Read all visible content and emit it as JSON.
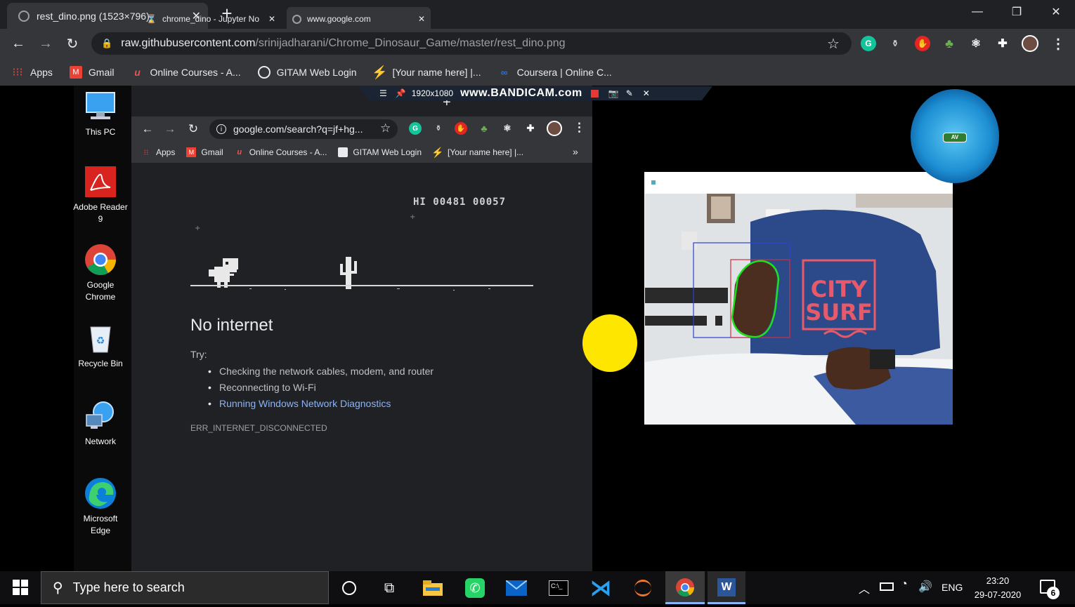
{
  "outer_browser": {
    "tab_title": "rest_dino.png (1523×796)",
    "url_host": "raw.githubusercontent.com",
    "url_path": "/srinijadharani/Chrome_Dinosaur_Game/master/rest_dino.png",
    "bookmarks": [
      {
        "label": "Apps",
        "icon": "apps-grid-icon"
      },
      {
        "label": "Gmail",
        "icon": "gmail-icon"
      },
      {
        "label": "Online Courses - A...",
        "icon": "udemy-icon"
      },
      {
        "label": "GITAM Web Login",
        "icon": "globe-icon"
      },
      {
        "label": "[Your name here] |...",
        "icon": "lightning-icon"
      },
      {
        "label": "Coursera | Online C...",
        "icon": "coursera-icon"
      }
    ]
  },
  "desktop_icons": [
    {
      "label": "This PC",
      "icon": "this-pc-icon"
    },
    {
      "label": "Adobe Reader 9",
      "icon": "adobe-reader-icon"
    },
    {
      "label": "Google Chrome",
      "icon": "chrome-icon"
    },
    {
      "label": "Recycle Bin",
      "icon": "recycle-bin-icon"
    },
    {
      "label": "Network",
      "icon": "network-icon"
    },
    {
      "label": "Microsoft Edge",
      "icon": "edge-icon"
    }
  ],
  "inner_browser": {
    "tabs": [
      {
        "title": "chrome_dino - Jupyter No"
      },
      {
        "title": "www.google.com"
      }
    ],
    "url": "google.com/search?q=jf+hg...",
    "bookmarks": [
      {
        "label": "Apps"
      },
      {
        "label": "Gmail"
      },
      {
        "label": "Online Courses - A..."
      },
      {
        "label": "GITAM Web Login"
      },
      {
        "label": "[Your name here] |..."
      }
    ],
    "more_bookmarks": "»",
    "game": {
      "hiscore": "HI 00481  00057"
    },
    "error": {
      "title": "No internet",
      "try": "Try:",
      "suggestions": [
        "Checking the network cables, modem, and router",
        "Reconnecting to Wi-Fi",
        "Running Windows Network Diagnostics"
      ],
      "code": "ERR_INTERNET_DISCONNECTED"
    }
  },
  "bandicam": {
    "resolution": "1920x1080",
    "brand": "www.BANDICAM.com"
  },
  "webcam": {
    "shirt_line1": "CITY",
    "shirt_line2": "SURF"
  },
  "taskbar": {
    "search_placeholder": "Type here to search",
    "language": "ENG",
    "time": "23:20",
    "date": "29-07-2020",
    "notification_count": "6"
  },
  "colors": {
    "chrome_dark": "#202124",
    "chrome_toolbar": "#35363a",
    "link_blue": "#8ab4f8",
    "yellow_dot": "#ffe600"
  }
}
